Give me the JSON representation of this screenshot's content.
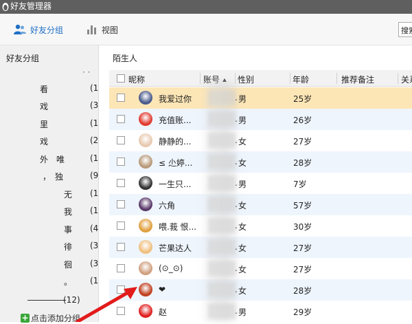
{
  "window": {
    "title": "好友管理器"
  },
  "toolbar": {
    "friends_group_label": "好友分组",
    "view_label": "视图",
    "search_placeholder": "搜索"
  },
  "sidebar": {
    "title": "好友分组",
    "groups": [
      {
        "name": "看",
        "count": "(1"
      },
      {
        "name": "戏",
        "count": "(3"
      },
      {
        "name": "里",
        "count": "(1"
      },
      {
        "name": "戏",
        "count": "(2"
      },
      {
        "name": "外　唯",
        "count": "(1"
      },
      {
        "name": "，　独",
        "count": "(9"
      },
      {
        "name": "无",
        "count": "(1"
      },
      {
        "name": "我",
        "count": "(1"
      },
      {
        "name": "事",
        "count": "(4"
      },
      {
        "name": "徘",
        "count": "(3"
      },
      {
        "name": "徊",
        "count": "(3"
      },
      {
        "name": "。",
        "count": "(1"
      }
    ],
    "line_group_count": "(12)",
    "add_group_label": "点击添加分组"
  },
  "main": {
    "title": "陌生人",
    "columns": {
      "nickname": "昵称",
      "account": "账号",
      "gender": "性别",
      "age": "年龄",
      "remark": "推荐备注",
      "relation": "关系"
    },
    "rows": [
      {
        "nickname": "我爱过你",
        "gender": "男",
        "age": "25岁",
        "selected": true,
        "avatar_color": "#4a5a8c"
      },
      {
        "nickname": "充值账...",
        "gender": "男",
        "age": "26岁",
        "selected": false,
        "avatar_color": "#e03a2f"
      },
      {
        "nickname": "静静的...",
        "gender": "女",
        "age": "27岁",
        "selected": false,
        "avatar_color": "#e8c9b0"
      },
      {
        "nickname": "≤ 尐婷...",
        "gender": "女",
        "age": "28岁",
        "selected": false,
        "avatar_color": "#b89a7a"
      },
      {
        "nickname": "一生只...",
        "gender": "男",
        "age": "7岁",
        "selected": false,
        "avatar_color": "#333333"
      },
      {
        "nickname": "六角",
        "gender": "女",
        "age": "57岁",
        "selected": false,
        "avatar_color": "#5a3a6a"
      },
      {
        "nickname": "喂.莪 恨...",
        "gender": "女",
        "age": "30岁",
        "selected": false,
        "avatar_color": "#e0a040"
      },
      {
        "nickname": "芒果达人",
        "gender": "女",
        "age": "27岁",
        "selected": false,
        "avatar_color": "#f0c080"
      },
      {
        "nickname": "(⊙_⊙)",
        "gender": "女",
        "age": "27岁",
        "selected": false,
        "avatar_color": "#d0a080"
      },
      {
        "nickname": "❤",
        "gender": "女",
        "age": "28岁",
        "selected": false,
        "avatar_color": "#c04020"
      },
      {
        "nickname": "赵",
        "gender": "男",
        "age": "29岁",
        "selected": false,
        "avatar_color": "#e02020"
      }
    ]
  },
  "colors": {
    "selected_row": "#fde6b6",
    "alt_row": "#eef5fd",
    "accent": "#1f6fc4",
    "annotation_arrow": "#e21b1b"
  },
  "icons": {
    "title": "penguin-icon",
    "friends": "users-icon",
    "view": "bar-chart-icon",
    "add": "plus-icon"
  }
}
